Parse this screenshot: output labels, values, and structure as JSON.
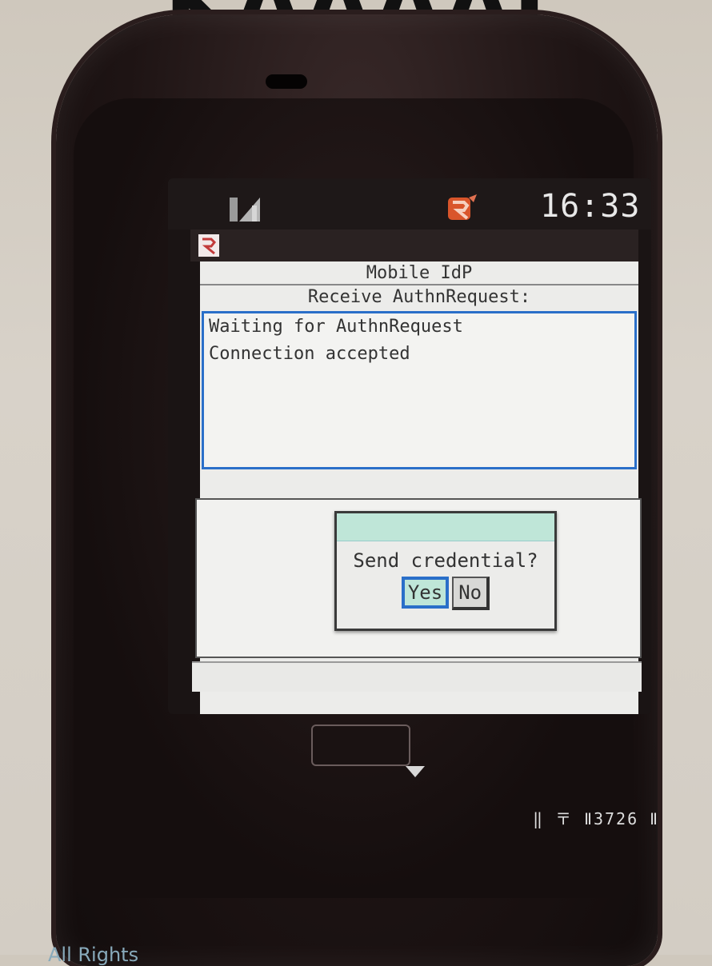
{
  "header_overlay": {
    "text": "KAAAAI"
  },
  "status_bar": {
    "signal_icon": "signal-icon",
    "app_icon": "app-status-icon",
    "time": "16:33"
  },
  "app": {
    "logo_icon": "app-logo-icon",
    "title": "Mobile IdP",
    "subtitle": "Receive AuthnRequest:",
    "log_lines": [
      "Waiting for AuthnRequest",
      "Connection accepted"
    ]
  },
  "dialog": {
    "question": "Send credential?",
    "yes_label": "Yes",
    "no_label": "No"
  },
  "device": {
    "model_text": "‖ 〒 Ⅱ3726 Ⅱ",
    "copyright_text": "All Rights"
  },
  "colors": {
    "accent_blue": "#2a6fc9",
    "dialog_header": "#bfe6d8",
    "app_icon_orange": "#d9552b"
  }
}
